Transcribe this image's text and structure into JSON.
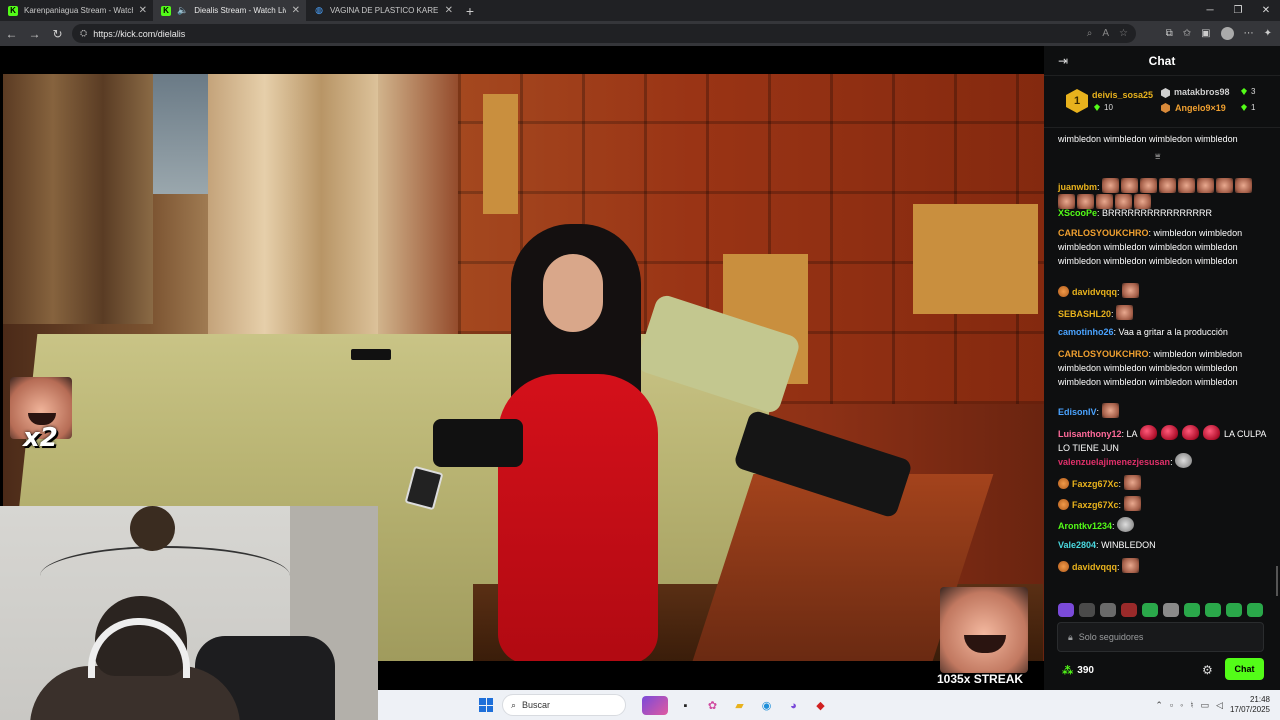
{
  "browser": {
    "tabs": [
      {
        "title": "Karenpaniagua Stream - Watch Li",
        "favicon": "K"
      },
      {
        "title": "Diealis Stream - Watch Live o",
        "favicon": "K"
      },
      {
        "title": "VAGINA DE PLASTICO KAREN PA",
        "favicon": "world-icon"
      }
    ],
    "url": "https://kick.com/dielalis"
  },
  "video": {
    "overlay_multiplier": "x2",
    "streak_label": "1035x STREAK"
  },
  "chat": {
    "title": "Chat",
    "leaderboard": {
      "first": {
        "name": "deivis_sosa25",
        "count": "10"
      },
      "second": {
        "name": "matakbros98",
        "count": "3"
      },
      "third": {
        "name": "Angelo9×19",
        "count": "1"
      }
    },
    "messages": [
      {
        "user": "",
        "user_color": "#ffffff",
        "text": "wimbledon wimbledon wimbledon wimbledon wimbledon wimbledon wimbledon wimbledon",
        "emotes": 0
      },
      {
        "user": "juanwbm",
        "user_color": "#e8b21d",
        "text": "",
        "emotes": 13
      },
      {
        "user": "XScooPe",
        "user_color": "#53fc18",
        "text": "BRRRRRRRRRRRRRRRR",
        "emotes": 0
      },
      {
        "user": "CARLOSYOUKCHRO",
        "user_color": "#f0a030",
        "text": "wimbledon wimbledon wimbledon wimbledon wimbledon wimbledon wimbledon wimbledon wimbledon wimbledon",
        "emotes": 0
      },
      {
        "user": "davidvqqq",
        "user_color": "#e8b21d",
        "text": "",
        "emotes": 1
      },
      {
        "user": "SEBASHL20",
        "user_color": "#e8b21d",
        "text": "",
        "emotes": 1
      },
      {
        "user": "camotinho26",
        "user_color": "#4aa3ff",
        "text": "Vaa a gritar a la producción",
        "emotes": 0
      },
      {
        "user": "CARLOSYOUKCHRO",
        "user_color": "#f0a030",
        "text": "wimbledon wimbledon wimbledon wimbledon wimbledon wimbledon wimbledon wimbledon wimbledon wimbledon",
        "emotes": 0
      },
      {
        "user": "EdisonIV",
        "user_color": "#4aa3ff",
        "text": "",
        "emotes": 1
      },
      {
        "user": "Luisanthony12",
        "user_color": "#ff6a9a",
        "text": "LA",
        "text2": "LA CULPA LO TIENE JUN",
        "emotes": 0
      },
      {
        "user": "valenzuelajimenezjesusan",
        "user_color": "#e0306a",
        "text": "",
        "emotes": 1
      },
      {
        "user": "Faxzg67Xc",
        "user_color": "#e8b21d",
        "text": "",
        "emotes": 1
      },
      {
        "user": "Faxzg67Xc",
        "user_color": "#e8b21d",
        "text": "",
        "emotes": 1
      },
      {
        "user": "Arontkv1234",
        "user_color": "#53fc18",
        "text": "",
        "emotes": 1
      },
      {
        "user": "Vale2804",
        "user_color": "#4ad9e0",
        "text": "WINBLEDON",
        "emotes": 0
      },
      {
        "user": "davidvqqq",
        "user_color": "#e8b21d",
        "text": "",
        "emotes": 1
      }
    ],
    "input_placeholder": "Solo seguidores",
    "points": "390",
    "send_label": "Chat",
    "colors": {
      "accent": "#53fc18",
      "background": "#0e0f10"
    }
  },
  "taskbar": {
    "search_label": "Buscar",
    "time": "21:48",
    "date": "17/07/2025"
  }
}
